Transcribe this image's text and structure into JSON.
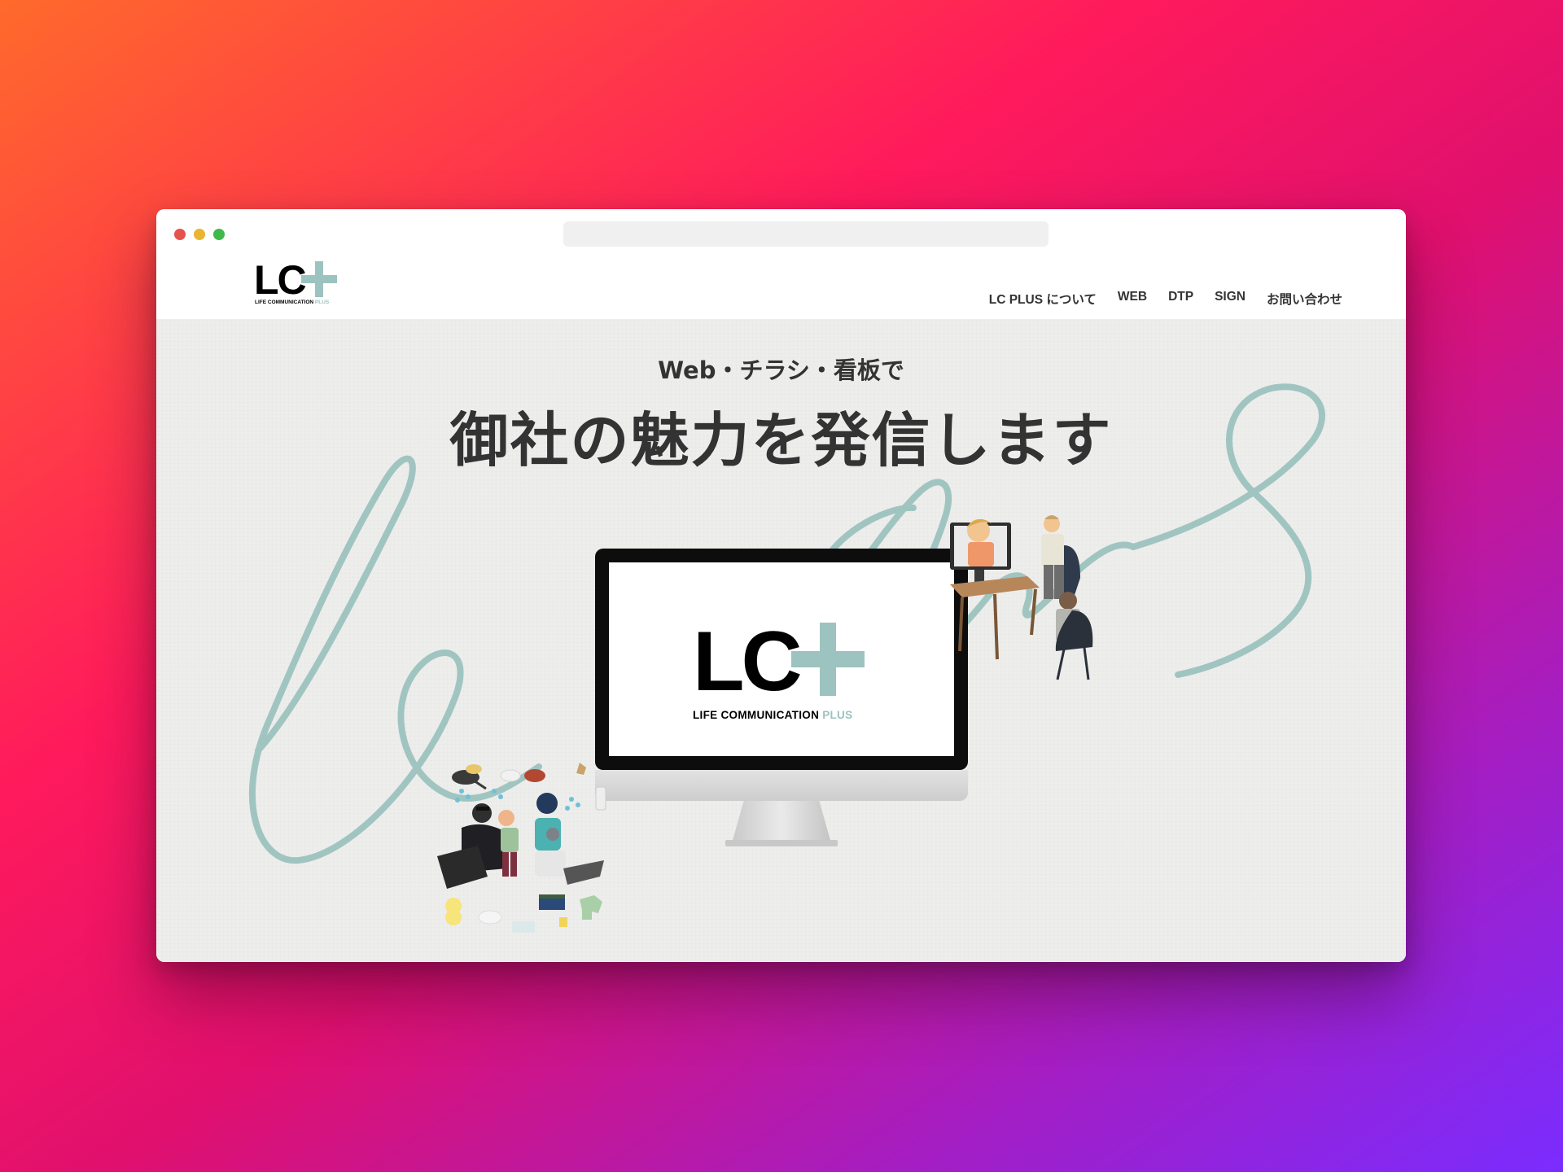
{
  "window": {
    "traffic_lights": [
      "close",
      "minimize",
      "maximize"
    ],
    "url": ""
  },
  "header": {
    "logo": {
      "text": "LC",
      "sub_text": "LIFE COMMUNICATION",
      "sub_accent": "PLUS"
    },
    "nav": [
      {
        "label": "LC PLUS について"
      },
      {
        "label": "WEB"
      },
      {
        "label": "DTP"
      },
      {
        "label": "SIGN"
      },
      {
        "label": "お問い合わせ"
      }
    ]
  },
  "hero": {
    "subheading": "Web・チラシ・看板で",
    "heading": "御社の魅力を発信します",
    "monitor_logo": {
      "text": "LC",
      "sub_text": "LIFE COMMUNICATION",
      "sub_accent": "PLUS"
    }
  },
  "colors": {
    "accent": "#9cc3bf",
    "text": "#333333",
    "hero_bg": "#ededec",
    "background_gradient": [
      "#ff6a2b",
      "#ff1a5c",
      "#a31ec4",
      "#7a2cff"
    ]
  },
  "icons": [
    "plus-icon",
    "meeting-illustration",
    "family-illustration"
  ]
}
